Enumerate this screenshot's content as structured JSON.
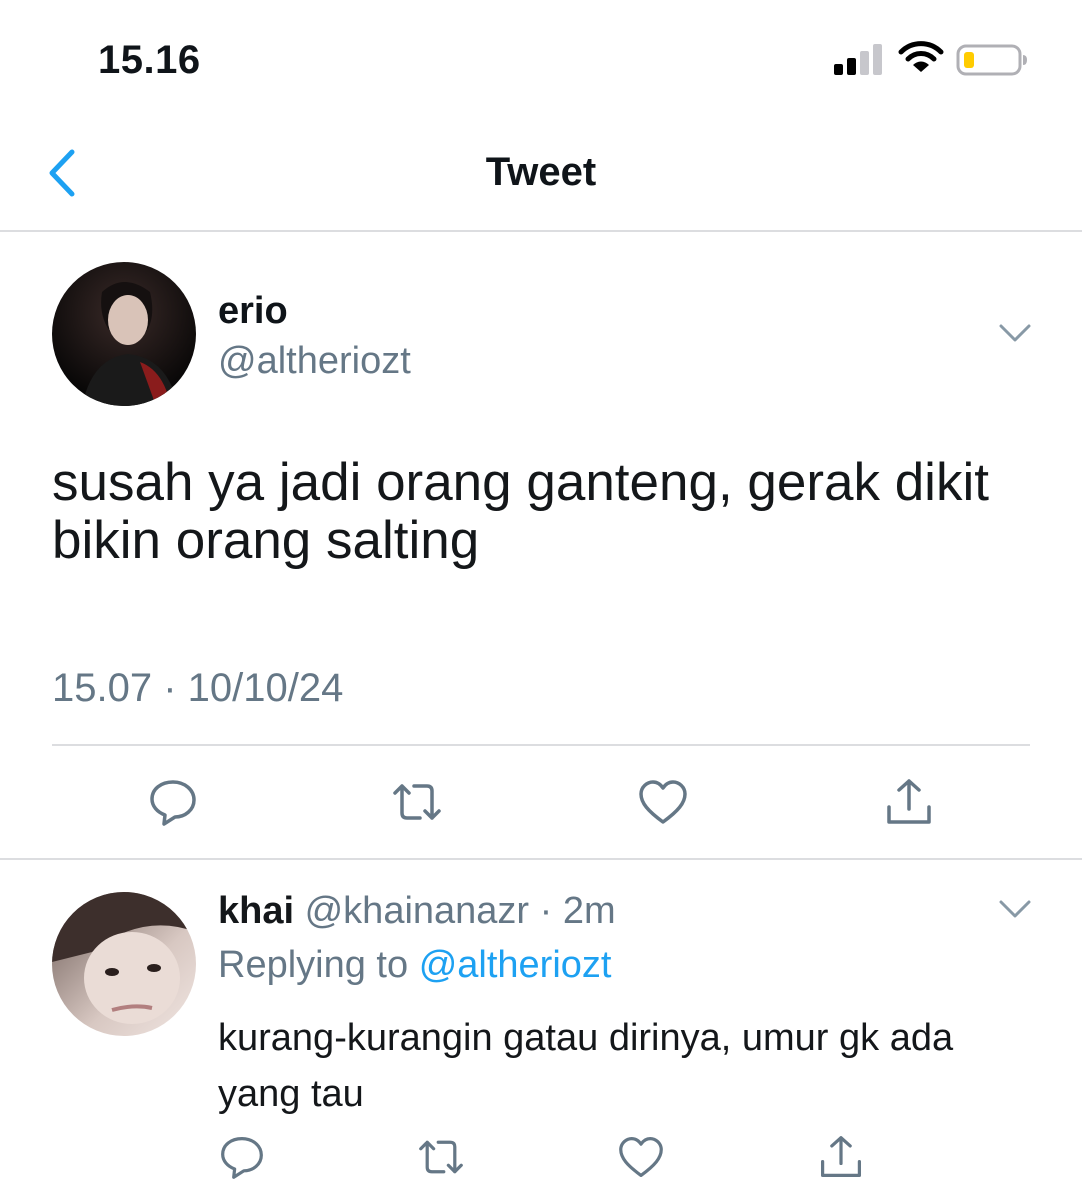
{
  "status_bar": {
    "time": "15.16"
  },
  "nav": {
    "title": "Tweet"
  },
  "tweet": {
    "display_name": "erio",
    "handle": "@altheriozt",
    "text": "susah ya jadi orang ganteng, gerak dikit bikin orang salting",
    "meta": "15.07 · 10/10/24"
  },
  "reply": {
    "display_name": "khai",
    "handle": "@khainanazr",
    "time": "· 2m",
    "replying_label": "Replying to",
    "replying_handle": "@altheriozt",
    "text": "kurang-kurangin gatau dirinya, umur gk ada yang tau"
  },
  "colors": {
    "accent": "#1da1f2",
    "muted": "#657786",
    "icon": "#657786",
    "divider": "#dcdde0"
  },
  "icons": [
    "signal-icon",
    "wifi-icon",
    "battery-icon",
    "back-chevron-icon",
    "chevron-down-icon",
    "reply-icon",
    "retweet-icon",
    "like-icon",
    "share-icon"
  ]
}
